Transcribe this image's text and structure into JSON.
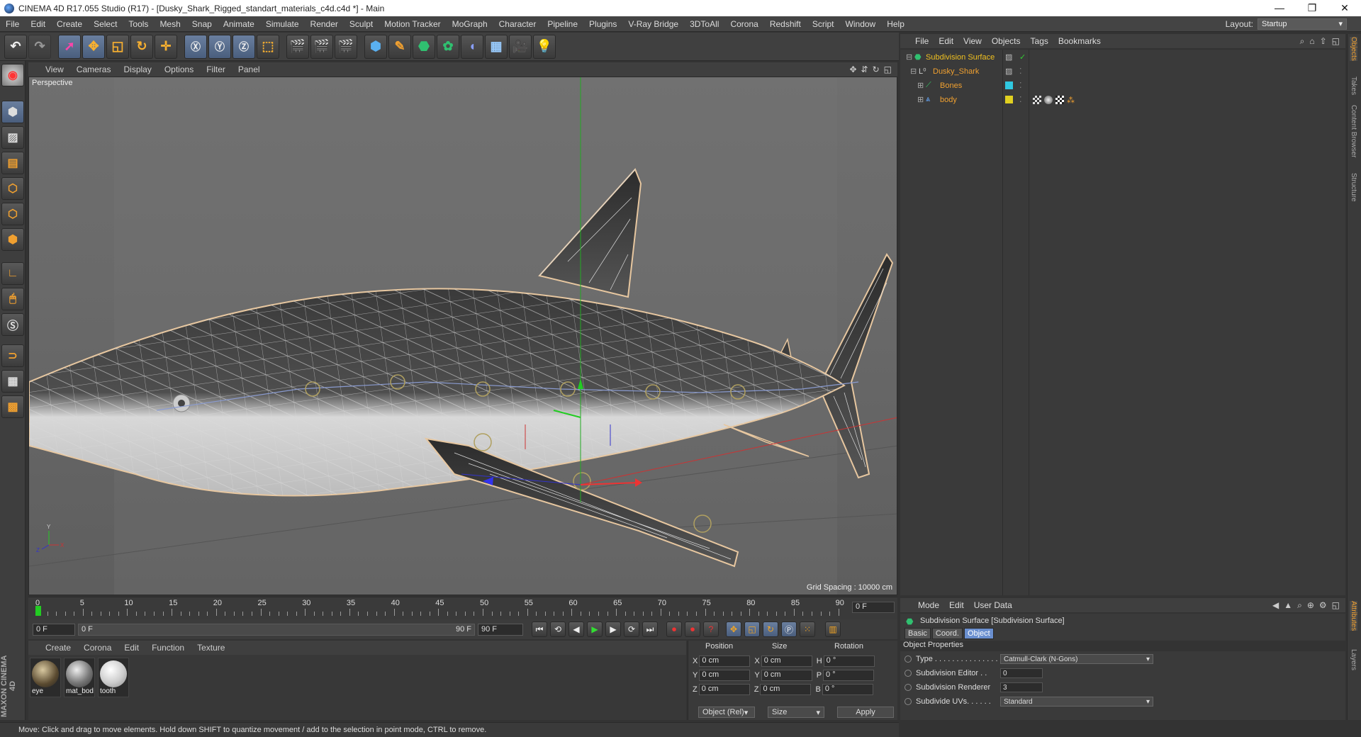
{
  "window": {
    "title": "CINEMA 4D R17.055 Studio (R17) - [Dusky_Shark_Rigged_standart_materials_c4d.c4d *] - Main"
  },
  "menubar": {
    "items": [
      "File",
      "Edit",
      "Create",
      "Select",
      "Tools",
      "Mesh",
      "Snap",
      "Animate",
      "Simulate",
      "Render",
      "Sculpt",
      "Motion Tracker",
      "MoGraph",
      "Character",
      "Pipeline",
      "Plugins",
      "V-Ray Bridge",
      "3DToAll",
      "Corona",
      "Redshift",
      "Script",
      "Window",
      "Help"
    ],
    "layout_label": "Layout:",
    "layout_value": "Startup"
  },
  "viewport": {
    "menu": [
      "View",
      "Cameras",
      "Display",
      "Options",
      "Filter",
      "Panel"
    ],
    "label": "Perspective",
    "grid_spacing": "Grid Spacing : 10000 cm"
  },
  "timeline": {
    "ticks": [
      "0",
      "5",
      "10",
      "15",
      "20",
      "25",
      "30",
      "35",
      "40",
      "45",
      "50",
      "55",
      "60",
      "65",
      "70",
      "75",
      "80",
      "85",
      "90"
    ],
    "current_frame": "0 F",
    "start": "0 F",
    "range_start": "0 F",
    "range_end": "90 F",
    "end": "90 F"
  },
  "materials": {
    "menu": [
      "Create",
      "Corona",
      "Edit",
      "Function",
      "Texture"
    ],
    "items": [
      {
        "name": "eye",
        "color": "#7a6a50"
      },
      {
        "name": "mat_bod",
        "color": "#8c8c8c"
      },
      {
        "name": "tooth",
        "color": "#e8e8e8"
      }
    ]
  },
  "coords": {
    "headers": {
      "position": "Position",
      "size": "Size",
      "rotation": "Rotation"
    },
    "rows": [
      {
        "axis": "X",
        "pos": "0 cm",
        "saxis": "X",
        "size": "0 cm",
        "raxis": "H",
        "rot": "0 °"
      },
      {
        "axis": "Y",
        "pos": "0 cm",
        "saxis": "Y",
        "size": "0 cm",
        "raxis": "P",
        "rot": "0 °"
      },
      {
        "axis": "Z",
        "pos": "0 cm",
        "saxis": "Z",
        "size": "0 cm",
        "raxis": "B",
        "rot": "0 °"
      }
    ],
    "mode": "Object (Rel)",
    "size_mode": "Size",
    "apply": "Apply"
  },
  "status": {
    "text": "Move: Click and drag to move elements. Hold down SHIFT to quantize movement / add to the selection in point mode, CTRL to remove."
  },
  "maxon": {
    "text": "MAXON CINEMA 4D"
  },
  "objects": {
    "menu": [
      "File",
      "Edit",
      "View",
      "Objects",
      "Tags",
      "Bookmarks"
    ],
    "tree": [
      {
        "name": "Subdivision Surface",
        "color": "#f0c020",
        "indent": 0,
        "swatch": ""
      },
      {
        "name": "Dusky_Shark",
        "color": "#f0a030",
        "indent": 1,
        "swatch": ""
      },
      {
        "name": "Bones",
        "color": "#f0a030",
        "indent": 2,
        "swatch": "#30c8e0"
      },
      {
        "name": "body",
        "color": "#f0a030",
        "indent": 2,
        "swatch": "#e0d020"
      }
    ]
  },
  "side_tabs": [
    "Objects",
    "Takes",
    "Content Browser",
    "Structure"
  ],
  "side_tabs_lower": [
    "Attributes",
    "Layers"
  ],
  "attributes": {
    "menu": [
      "Mode",
      "Edit",
      "User Data"
    ],
    "title": "Subdivision Surface [Subdivision Surface]",
    "tabs": [
      "Basic",
      "Coord.",
      "Object"
    ],
    "active_tab": "Object",
    "section": "Object Properties",
    "rows": [
      {
        "label": "Type . . . . . . . . . . . . . . .",
        "value": "Catmull-Clark (N-Gons)",
        "kind": "select"
      },
      {
        "label": "Subdivision Editor . .",
        "value": "0",
        "kind": "num"
      },
      {
        "label": "Subdivision Renderer",
        "value": "3",
        "kind": "num"
      },
      {
        "label": "Subdivide UVs. . . . . .",
        "value": "Standard",
        "kind": "select"
      }
    ]
  },
  "colors": {
    "accent": "#f0a030",
    "active_tab": "#6a8fcf",
    "panel": "#3a3a3a"
  }
}
